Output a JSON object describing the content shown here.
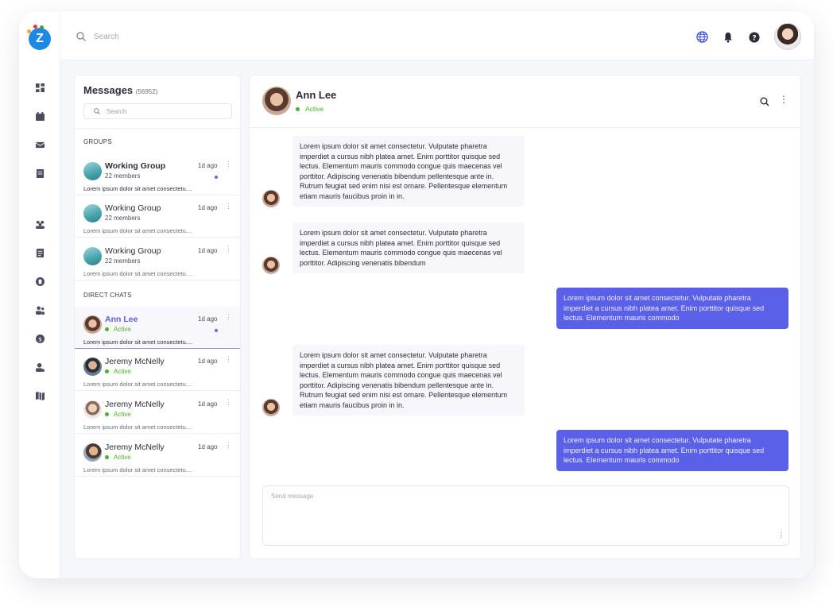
{
  "app": {
    "logo_letter": "Z"
  },
  "topbar": {
    "search_placeholder": "Search"
  },
  "messages": {
    "title": "Messages",
    "count": "(56952)",
    "search_placeholder": "Search",
    "groups_label": "GROUPS",
    "groups": [
      {
        "name": "Working Group",
        "members": "22 members",
        "time": "1d ago",
        "preview": "Lorem ipsum dolor sit amet consectetu....",
        "unread": true
      },
      {
        "name": "Working Group",
        "members": "22 members",
        "time": "1d ago",
        "preview": "Lorem ipsum dolor sit amet consectetu....",
        "unread": false
      },
      {
        "name": "Working Group",
        "members": "22 members",
        "time": "1d ago",
        "preview": "Lorem ipsum dolor sit amet consectetu....",
        "unread": false
      }
    ],
    "direct_label": "DIRECT CHATS",
    "direct": [
      {
        "name": "Ann Lee",
        "status": "Active",
        "time": "1d ago",
        "preview": "Lorem ipsum dolor sit amet consectetu....",
        "selected": true,
        "unread": true
      },
      {
        "name": "Jeremy McNelly",
        "status": "Active",
        "time": "1d ago",
        "preview": "Lorem ipsum dolor sit amet consectetu....",
        "selected": false,
        "unread": false
      },
      {
        "name": "Jeremy McNelly",
        "status": "Active",
        "time": "1d ago",
        "preview": "Lorem ipsum dolor sit amet consectetu....",
        "selected": false,
        "unread": false
      },
      {
        "name": "Jeremy McNelly",
        "status": "Active",
        "time": "1d ago",
        "preview": "Lorem ipsum dolor sit amet consectetu....",
        "selected": false,
        "unread": false
      }
    ]
  },
  "conversation": {
    "name": "Ann Lee",
    "status": "Active",
    "messages": [
      {
        "direction": "in",
        "text": "Lorem ipsum dolor sit amet consectetur. Vulputate pharetra imperdiet a cursus nibh platea amet. Enim porttitor quisque sed lectus. Elementum mauris commodo congue quis maecenas vel porttitor. Adipiscing venenatis bibendum pellentesque ante in. Rutrum feugiat sed enim nisi est ornare. Pellentesque elementum etiam mauris faucibus proin in in."
      },
      {
        "direction": "in",
        "text": "Lorem ipsum dolor sit amet consectetur. Vulputate pharetra imperdiet a cursus nibh platea amet. Enim porttitor quisque sed lectus. Elementum mauris commodo congue quis maecenas vel porttitor. Adipiscing venenatis bibendum"
      },
      {
        "direction": "out",
        "text": "Lorem ipsum dolor sit amet consectetur. Vulputate pharetra imperdiet a cursus nibh platea amet. Enim porttitor quisque sed lectus. Elementum mauris commodo"
      },
      {
        "direction": "in",
        "text": "Lorem ipsum dolor sit amet consectetur. Vulputate pharetra imperdiet a cursus nibh platea amet. Enim porttitor quisque sed lectus. Elementum mauris commodo congue quis maecenas vel porttitor. Adipiscing venenatis bibendum pellentesque ante in. Rutrum feugiat sed enim nisi est ornare. Pellentesque elementum etiam mauris faucibus proin in in."
      },
      {
        "direction": "out",
        "text": "Lorem ipsum dolor sit amet consectetur. Vulputate pharetra imperdiet a cursus nibh platea amet. Enim porttitor quisque sed lectus. Elementum mauris commodo"
      }
    ],
    "composer_placeholder": "Send message"
  },
  "icons": {
    "rail": [
      "dashboard-icon",
      "calendar-icon",
      "mail-icon",
      "document-icon",
      "team-icon",
      "notes-icon",
      "badge-icon",
      "users-icon",
      "dollar-icon",
      "user-settings-icon",
      "map-icon"
    ],
    "topbar": [
      "globe-icon",
      "bell-icon",
      "help-icon"
    ]
  },
  "colors": {
    "accent": "#5b60e8",
    "active_status": "#47b22a",
    "logo": "#1e88e5"
  }
}
